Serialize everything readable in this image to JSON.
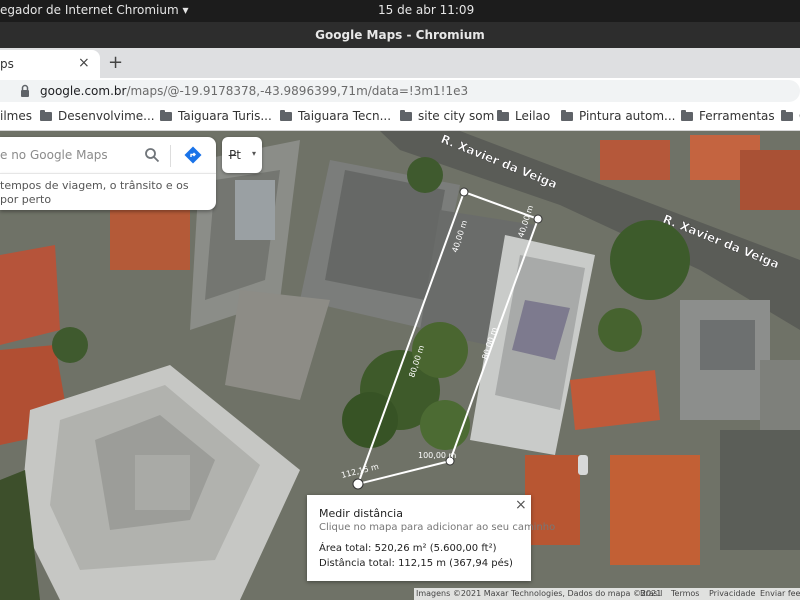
{
  "topbar": {
    "app_menu": "egador de Internet Chromium ▾",
    "clock": "15 de abr  11:09"
  },
  "window": {
    "title": "Google Maps - Chromium"
  },
  "tab": {
    "title": "ps",
    "close": "×",
    "new_tab": "+"
  },
  "omnibox": {
    "domain": "google.com.br",
    "path": "/maps/@-19.9178378,-43.9896399,71m/data=!3m1!1e3"
  },
  "bookmarks": [
    {
      "label": "ilmes"
    },
    {
      "label": "Desenvolvime..."
    },
    {
      "label": "Taiguara Turis..."
    },
    {
      "label": "Taiguara Tecn..."
    },
    {
      "label": "site city som"
    },
    {
      "label": "Leilao"
    },
    {
      "label": "Pintura autom..."
    },
    {
      "label": "Ferramentas"
    },
    {
      "label": "C"
    }
  ],
  "search": {
    "placeholder": "e no Google Maps",
    "suggest_line1": "tempos de viagem, o trânsito e os",
    "suggest_line2": "por perto"
  },
  "chip": {
    "label": "P̶t",
    "arrow": "▾"
  },
  "map": {
    "streets": [
      "R. Xavier da Veiga",
      "R. Xavier da Veiga"
    ],
    "measure_labels": [
      "40,00 m",
      "40,00 m",
      "80,00 m",
      "80,00 m",
      "100,00 m",
      "112,15 m"
    ]
  },
  "measure": {
    "title": "Medir distância",
    "hint": "Clique no mapa para adicionar ao seu caminho",
    "area": "Área total: 520,26 m² (5.600,00 ft²)",
    "distance": "Distância total: 112,15 m (367,94 pés)",
    "close": "×"
  },
  "footer": {
    "imagery": "Imagens ©2021 Maxar Technologies, Dados do mapa ©2021",
    "country": "Brasil",
    "terms": "Termos",
    "privacy": "Privacidade",
    "feedback": "Enviar fee"
  },
  "colors": {
    "accent": "#1a73e8",
    "topbar": "#1c1c1c",
    "titlebar": "#2d2d2d"
  },
  "icons": [
    "lock-icon",
    "search-icon",
    "directions-icon",
    "folder-icon",
    "close-icon"
  ]
}
